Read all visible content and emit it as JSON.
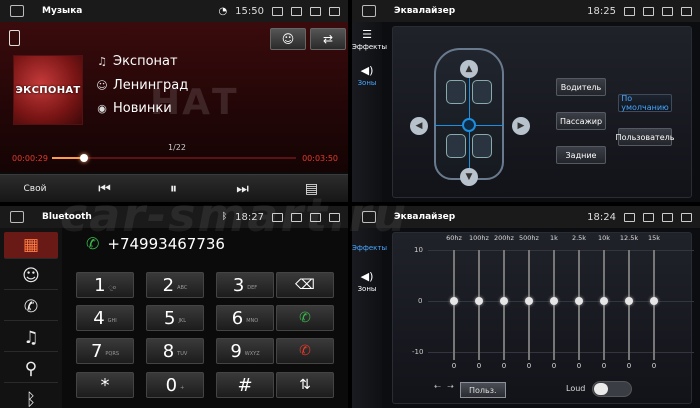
{
  "watermark": "car-smart.ru",
  "music": {
    "title": "Музыка",
    "time": "15:50",
    "track": "Экспонат",
    "artist": "Ленинград",
    "album": "Новинки",
    "cover_text": "ЭКСПОНАТ",
    "bg_text": "НАТ",
    "page": "1/22",
    "elapsed": "00:00:29",
    "total": "00:03:50",
    "progress": 0.13,
    "ctrl_label": "Свой",
    "icons": {
      "person": "person-icon",
      "repeat": "repeat-icon"
    }
  },
  "zones": {
    "title": "Эквалайзер",
    "time": "18:25",
    "side": [
      "Эффекты",
      "Зоны"
    ],
    "buttons": [
      "Водитель",
      "Пассажир",
      "Задние",
      "По умолчанию",
      "Пользователь"
    ]
  },
  "bt": {
    "title": "Bluetooth",
    "time": "18:27",
    "number": "+74993467736",
    "keys": [
      {
        "d": "1",
        "l": "◌̲o"
      },
      {
        "d": "2",
        "l": "ABC"
      },
      {
        "d": "3",
        "l": "DEF"
      },
      {
        "d": "4",
        "l": "GHI"
      },
      {
        "d": "5",
        "l": "JKL"
      },
      {
        "d": "6",
        "l": "MNO"
      },
      {
        "d": "7",
        "l": "PQRS"
      },
      {
        "d": "8",
        "l": "TUV"
      },
      {
        "d": "9",
        "l": "WXYZ"
      },
      {
        "d": "*",
        "l": ""
      },
      {
        "d": "0",
        "l": "+"
      },
      {
        "d": "#",
        "l": ""
      }
    ]
  },
  "eq": {
    "title": "Эквалайзер",
    "time": "18:24",
    "side": [
      "Эффекты",
      "Зоны"
    ],
    "scale": [
      "10",
      "0",
      "-10"
    ],
    "bands": [
      "60hz",
      "100hz",
      "200hz",
      "500hz",
      "1k",
      "2.5k",
      "10k",
      "12.5k",
      "15k"
    ],
    "values": [
      "0",
      "0",
      "0",
      "0",
      "0",
      "0",
      "0",
      "0",
      "0"
    ],
    "preset": "Польз.",
    "loud": "Loud"
  }
}
